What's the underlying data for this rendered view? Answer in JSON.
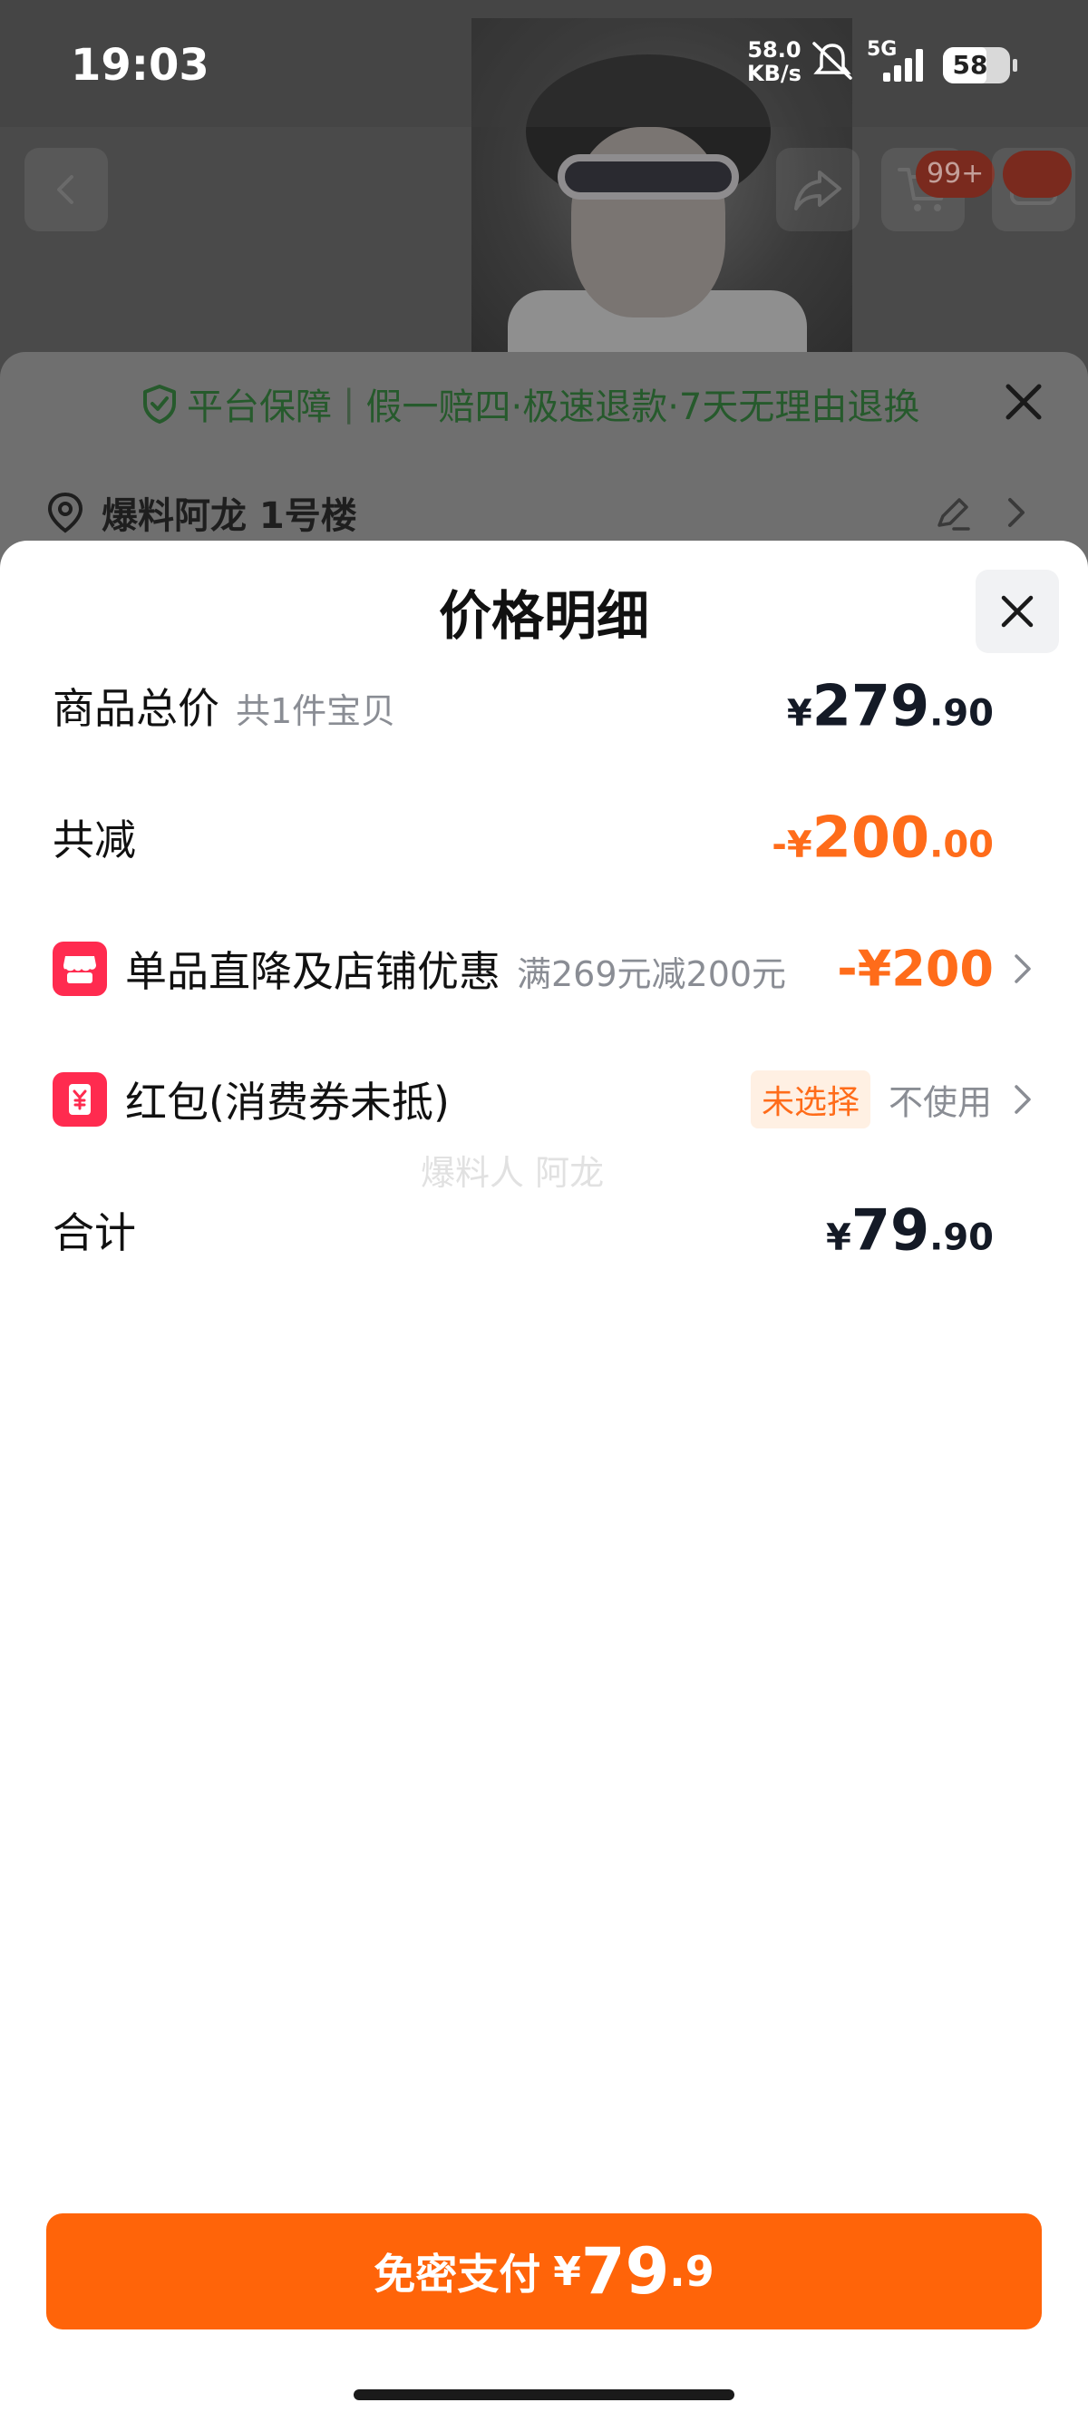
{
  "status_bar": {
    "time": "19:03",
    "net_speed_value": "58.0",
    "net_speed_unit": "KB/s",
    "network": "5G",
    "battery": "58"
  },
  "background": {
    "cart_badge": "99+",
    "guarantee": {
      "title": "平台保障",
      "separator": "|",
      "text": "假一赔四·极速退款·7天无理由退换"
    },
    "address": "爆料阿龙 1号楼"
  },
  "sheet": {
    "title": "价格明细",
    "rows": {
      "total_goods": {
        "label": "商品总价",
        "sub": "共1件宝贝",
        "currency": "¥",
        "int": "279",
        "dec": ".90"
      },
      "reduction": {
        "label": "共减",
        "currency": "-¥",
        "int": "200",
        "dec": ".00"
      },
      "shop_discount": {
        "label": "单品直降及店铺优惠",
        "sub": "满269元减200元",
        "value": "-¥200"
      },
      "red_packet": {
        "label": "红包(消费券未抵)",
        "tag": "未选择",
        "value": "不使用"
      },
      "sum": {
        "label": "合计",
        "currency": "¥",
        "int": "79",
        "dec": ".90"
      }
    },
    "watermark": "爆料人 阿龙"
  },
  "pay_button": {
    "label": "免密支付",
    "currency": "¥",
    "int": "79",
    "dec": ".9"
  },
  "colors": {
    "accent": "#ff6409",
    "discount": "#ff6c1a",
    "icon_red": "#ff2b4f"
  },
  "icons": [
    "back-icon",
    "share-icon",
    "cart-icon",
    "message-icon",
    "shield-check-icon",
    "close-icon",
    "location-pin-icon",
    "edit-icon",
    "chevron-right-icon",
    "shop-icon",
    "yuan-coupon-icon"
  ]
}
